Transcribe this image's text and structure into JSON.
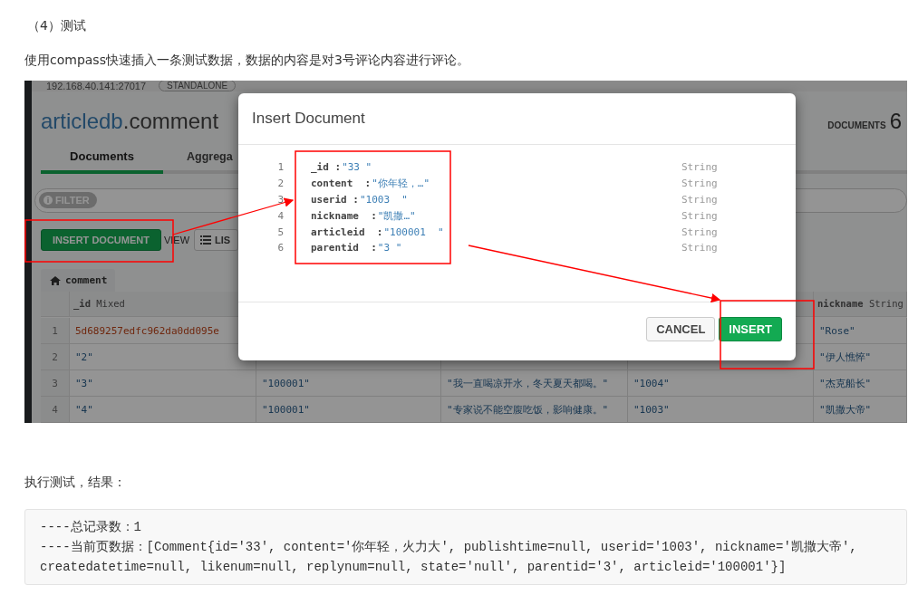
{
  "heading": "（4）测试",
  "intro": "使用compass快速插入一条测试数据，数据的内容是对3号评论内容进行评论。",
  "compass": {
    "connection": {
      "host": "192.168.40.141:27017",
      "badge": "STANDALONE"
    },
    "database": "articledb",
    "collection": ".comment",
    "documents": {
      "label": "DOCUMENTS",
      "count": "6"
    },
    "tabs": [
      {
        "label": "Documents",
        "selected": true
      },
      {
        "label": "Aggrega",
        "selected": false
      }
    ],
    "filter": "FILTER",
    "insert_button": "INSERT DOCUMENT",
    "view_label": "VIEW",
    "list_button": "LIS",
    "table_tab": "comment",
    "columns": [
      "**_id** Mixed",
      null,
      null,
      null,
      "**nickname** String"
    ],
    "rows": [
      {
        "index": "1",
        "kind": "objectid",
        "cells": [
          "5d689257edfc962da0dd095e",
          null,
          null,
          null,
          "\"Rose\""
        ]
      },
      {
        "index": "2",
        "kind": "string",
        "cells": [
          "\"2\"",
          null,
          null,
          null,
          "\"伊人憔悴\""
        ]
      },
      {
        "index": "3",
        "kind": "string",
        "cells": [
          "\"3\"",
          "\"100001\"",
          "\"我一直喝凉开水，冬天夏天都喝。\"",
          "\"1004\"",
          "\"杰克船长\""
        ]
      },
      {
        "index": "4",
        "kind": "string",
        "cells": [
          "\"4\"",
          "\"100001\"",
          "\"专家说不能空腹吃饭，影响健康。\"",
          "\"1003\"",
          "\"凯撒大帝\""
        ]
      }
    ]
  },
  "modal": {
    "title": "Insert Document",
    "fields": [
      {
        "line": "1",
        "key": "_id :",
        "value": "\"33 \"",
        "type": "String"
      },
      {
        "line": "2",
        "key": "content  :",
        "value": "\"你年轻，…\"",
        "type": "String"
      },
      {
        "line": "3",
        "key": "userid :",
        "value": "\"1003  \"",
        "type": "String"
      },
      {
        "line": "4",
        "key": "nickname  :",
        "value": "\"凯撒…\"",
        "type": "String"
      },
      {
        "line": "5",
        "key": "articleid  :",
        "value": "\"100001  \"",
        "type": "String"
      },
      {
        "line": "6",
        "key": "parentid  :",
        "value": "\"3 \"",
        "type": "String"
      }
    ],
    "buttons": [
      {
        "label": "CANCEL",
        "kind": "secondary"
      },
      {
        "label": "INSERT",
        "kind": "primary"
      }
    ]
  },
  "result_label": "执行测试，结果：",
  "output": [
    "----总记录数：1",
    "----当前页数据：[Comment{id='33', content='你年轻，火力大', publishtime=null, userid='1003', nickname='凯撒大帝', createdatetime=null, likenum=null, replynum=null, state='null', parentid='3', articleid='100001'}]"
  ]
}
